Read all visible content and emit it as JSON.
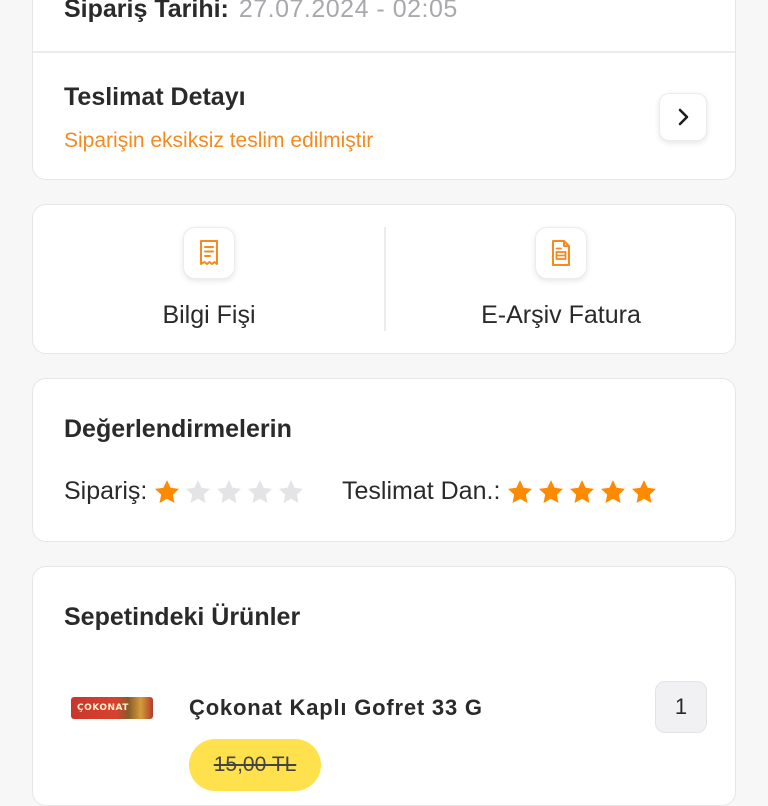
{
  "order": {
    "date_label": "Sipariş Tarihi:",
    "date_value": "27.07.2024 - 02:05"
  },
  "delivery": {
    "title": "Teslimat Detayı",
    "status": "Siparişin eksiksiz teslim edilmiştir",
    "chevron_icon": "chevron-right-icon"
  },
  "documents": [
    {
      "label": "Bilgi Fişi",
      "icon": "receipt-icon"
    },
    {
      "label": "E-Arşiv Fatura",
      "icon": "invoice-icon"
    }
  ],
  "ratings": {
    "title": "Değerlendirmelerin",
    "order_label": "Sipariş:",
    "order_stars": 1,
    "delivery_label": "Teslimat Dan.:",
    "delivery_stars": 5,
    "max_stars": 5
  },
  "basket": {
    "title": "Sepetindeki Ürünler",
    "items": [
      {
        "name": "Çokonat Kaplı Gofret 33 G",
        "image_text": "ÇOKONAT",
        "quantity": "1",
        "old_price": "15,00 TL"
      }
    ]
  },
  "colors": {
    "accent": "#f58a1f",
    "star_filled": "#ff8a00",
    "star_empty": "#e4e4e6",
    "price_pill": "#ffe14d"
  }
}
